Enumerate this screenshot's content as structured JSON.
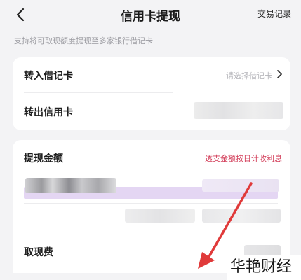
{
  "nav": {
    "title": "信用卡提现",
    "right_link": "交易记录",
    "back_icon": "back-arrow-icon"
  },
  "tip_text": "支持将可取现额度提现至多家银行借记卡",
  "transfer_card": {
    "debit_label": "转入借记卡",
    "debit_placeholder": "请选择借记卡",
    "credit_label": "转出信用卡"
  },
  "withdraw": {
    "amount_label": "提现金额",
    "overdraft_link": "透支金额按日计收利息",
    "fee_label": "取现费"
  },
  "watermark": "华艳财经",
  "colors": {
    "background": "#f3f3f5",
    "card": "#ffffff",
    "link_red": "#d23b57",
    "highlight_purple": "#e4d6f3",
    "annotation_arrow": "#e03a3a"
  }
}
